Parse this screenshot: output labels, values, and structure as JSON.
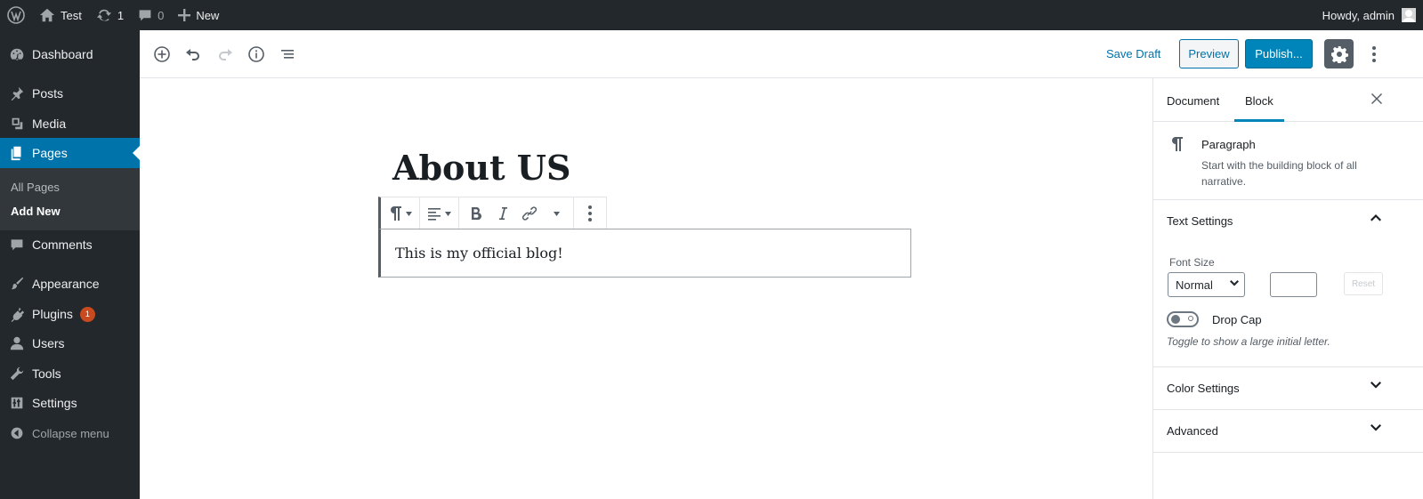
{
  "adminbar": {
    "site_name": "Test",
    "updates_count": "1",
    "comments_count": "0",
    "new_label": "New",
    "howdy": "Howdy, admin"
  },
  "menu": {
    "dashboard": "Dashboard",
    "posts": "Posts",
    "media": "Media",
    "pages": "Pages",
    "sub_all_pages": "All Pages",
    "sub_add_new": "Add New",
    "comments": "Comments",
    "appearance": "Appearance",
    "plugins": "Plugins",
    "plugins_badge": "1",
    "users": "Users",
    "tools": "Tools",
    "settings": "Settings",
    "collapse": "Collapse menu"
  },
  "header": {
    "save_draft": "Save Draft",
    "preview": "Preview",
    "publish": "Publish..."
  },
  "canvas": {
    "title": "About US",
    "paragraph": "This is my official blog!"
  },
  "sidebar": {
    "tab_document": "Document",
    "tab_block": "Block",
    "block_name": "Paragraph",
    "block_desc": "Start with the building block of all narrative.",
    "text_settings": "Text Settings",
    "font_size_label": "Font Size",
    "font_size_value": "Normal",
    "reset": "Reset",
    "drop_cap": "Drop Cap",
    "drop_cap_help": "Toggle to show a large initial letter.",
    "color_settings": "Color Settings",
    "advanced": "Advanced"
  },
  "colors": {
    "admin_bg": "#23282d",
    "accent": "#0073aa",
    "publish": "#0085ba",
    "badge": "#ca4a1f"
  },
  "icons": {
    "wp_logo": "wordpress-icon",
    "home": "home-icon",
    "updates": "updates-icon",
    "comment": "comment-icon",
    "plus": "plus-icon"
  }
}
